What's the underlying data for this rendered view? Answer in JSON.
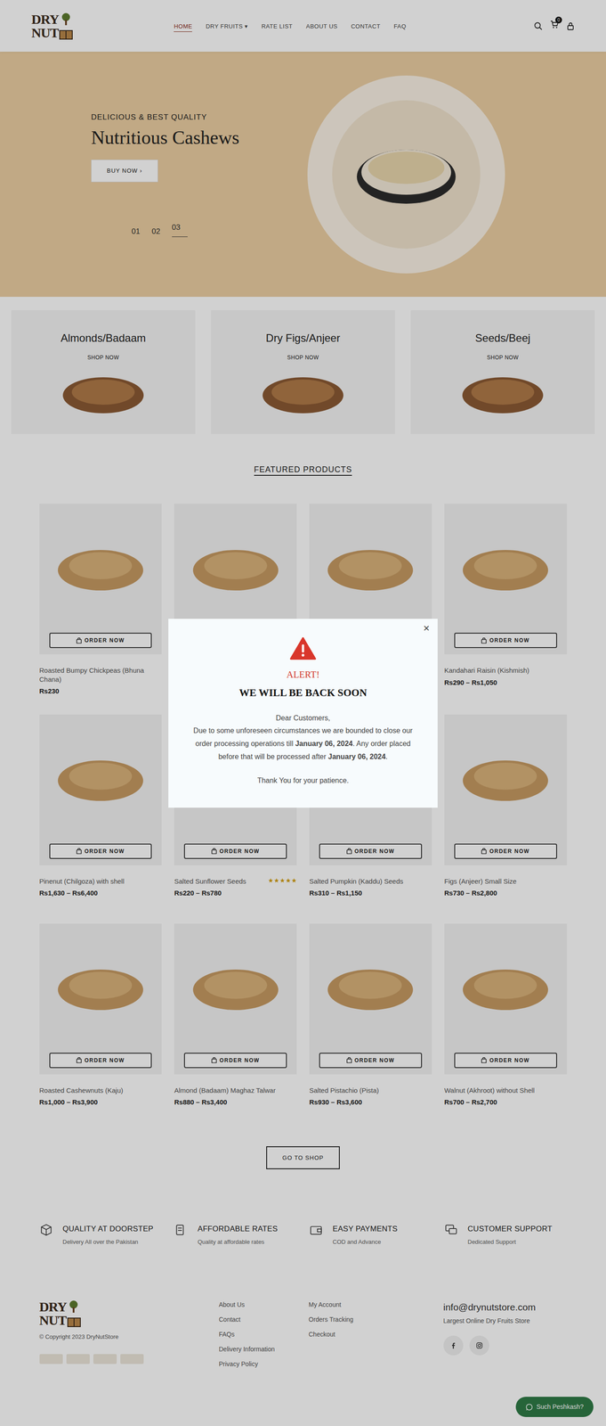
{
  "header": {
    "logo": {
      "line1": "DRY",
      "line2": "NUT"
    },
    "nav": [
      {
        "label": "HOME",
        "selected": true,
        "caret": ""
      },
      {
        "label": "DRY FRUITS",
        "selected": false,
        "caret": "▾"
      },
      {
        "label": "RATE LIST",
        "selected": false,
        "caret": ""
      },
      {
        "label": "ABOUT US",
        "selected": false,
        "caret": ""
      },
      {
        "label": "CONTACT",
        "selected": false,
        "caret": ""
      },
      {
        "label": "FAQ",
        "selected": false,
        "caret": ""
      }
    ],
    "cart_count": "0"
  },
  "hero": {
    "kicker": "DELICIOUS & BEST QUALITY",
    "title": "Nutritious Cashews",
    "button": "BUY NOW ›",
    "slides": [
      {
        "label": "01",
        "selected": false
      },
      {
        "label": "02",
        "selected": false
      },
      {
        "label": "03",
        "selected": true
      }
    ]
  },
  "categories": [
    {
      "title": "Almonds/Badaam",
      "link": "SHOP NOW"
    },
    {
      "title": "Dry Figs/Anjeer",
      "link": "SHOP NOW"
    },
    {
      "title": "Seeds/Beej",
      "link": "SHOP NOW"
    }
  ],
  "featured_title": "FEATURED PRODUCTS",
  "products": [
    {
      "name": "Roasted Bumpy Chickpeas (Bhuna Chana)",
      "price": "Rs230",
      "button": "ORDER NOW"
    },
    {
      "name": "",
      "price": "",
      "button": ""
    },
    {
      "name": "",
      "price": "",
      "button": ""
    },
    {
      "name": "Kandahari Raisin (Kishmish)",
      "price": "Rs290 – Rs1,050",
      "button": "ORDER NOW"
    },
    {
      "name": "Pinenut (Chilgoza) with shell",
      "price": "Rs1,630 – Rs6,400",
      "button": "ORDER NOW"
    },
    {
      "name": "Salted Sunflower Seeds",
      "price": "Rs220 – Rs780",
      "button": "ORDER NOW",
      "stars": 5
    },
    {
      "name": "Salted Pumpkin (Kaddu) Seeds",
      "price": "Rs310 – Rs1,150",
      "button": "ORDER NOW"
    },
    {
      "name": "Figs (Anjeer) Small Size",
      "price": "Rs730 – Rs2,800",
      "button": "ORDER NOW"
    },
    {
      "name": "Roasted Cashewnuts (Kaju)",
      "price": "Rs1,000 – Rs3,900",
      "button": "ORDER NOW"
    },
    {
      "name": "Almond (Badaam) Maghaz Talwar",
      "price": "Rs880 – Rs3,400",
      "button": "ORDER NOW"
    },
    {
      "name": "Salted Pistachio (Pista)",
      "price": "Rs930 – Rs3,600",
      "button": "ORDER NOW"
    },
    {
      "name": "Walnut (Akhroot) without Shell",
      "price": "Rs700 – Rs2,700",
      "button": "ORDER NOW"
    }
  ],
  "shop_button": "GO TO SHOP",
  "features": [
    {
      "title": "QUALITY AT DOORSTEP",
      "subtitle": "Delivery All over the Pakistan"
    },
    {
      "title": "AFFORDABLE RATES",
      "subtitle": "Quality at affordable rates"
    },
    {
      "title": "EASY PAYMENTS",
      "subtitle": "COD and Advance"
    },
    {
      "title": "CUSTOMER SUPPORT",
      "subtitle": "Dedicated Support"
    }
  ],
  "footer": {
    "copyright": "© Copyright 2023 DryNutStore",
    "links1": [
      "About Us",
      "Contact",
      "FAQs",
      "Delivery Information",
      "Privacy Policy"
    ],
    "links2": [
      "My Account",
      "Orders Tracking",
      "Checkout"
    ],
    "email": "info@drynutstore.com",
    "tagline": "Largest Online Dry Fruits Store"
  },
  "chat": {
    "label": "Such Peshkash?"
  },
  "modal": {
    "close": "×",
    "heading": "ALERT!",
    "title": "WE WILL BE BACK SOON",
    "greeting": "Dear Customers,",
    "message": [
      {
        "text": "Due to some unforeseen circumstances we are bounded to close our order processing operations till ",
        "bold": false
      },
      {
        "text": "January 06, 2024",
        "bold": true
      },
      {
        "text": ". Any order placed before that will be processed after ",
        "bold": false
      },
      {
        "text": "January 06, 2024",
        "bold": true
      },
      {
        "text": ".",
        "bold": false
      }
    ],
    "thanks": "Thank You for your patience."
  }
}
